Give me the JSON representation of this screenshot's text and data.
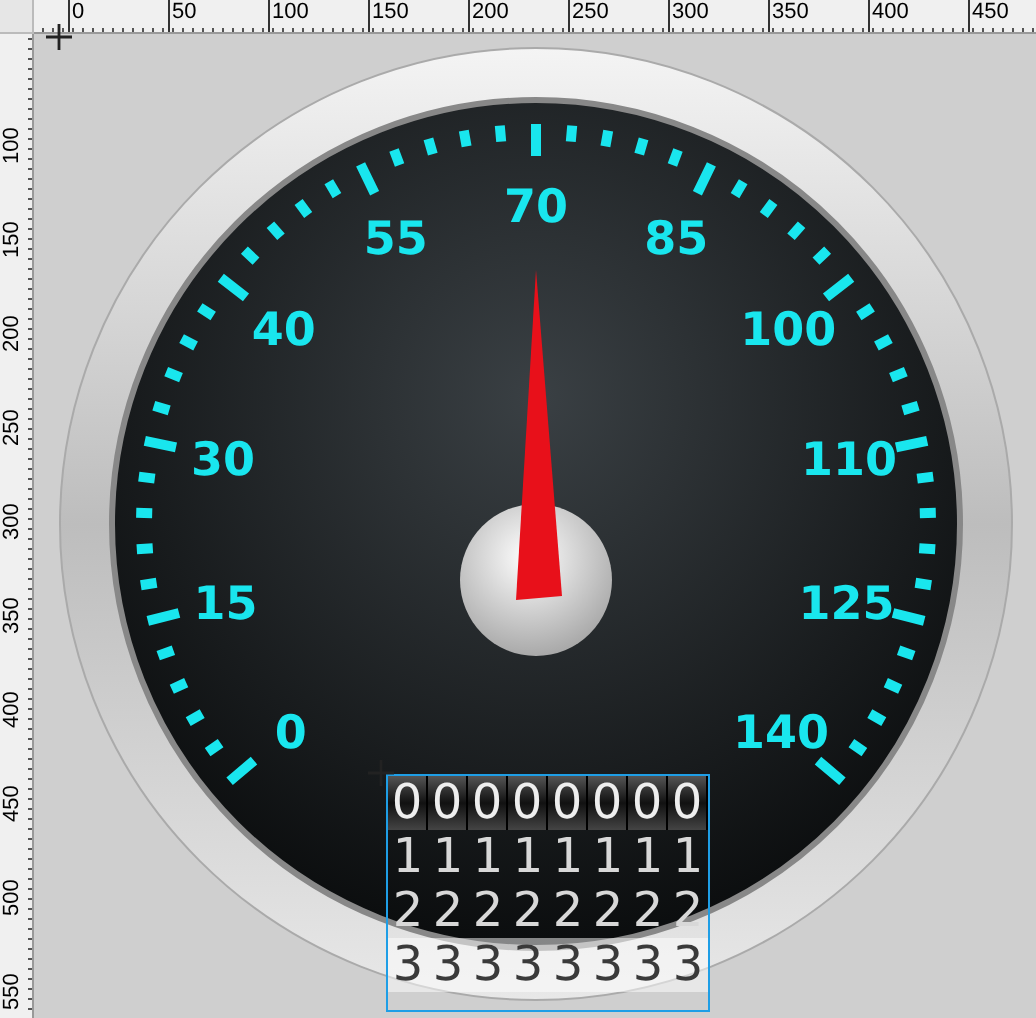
{
  "ruler": {
    "top_labels": [
      "0",
      "50",
      "100",
      "150",
      "200",
      "250",
      "300",
      "350",
      "400",
      "450"
    ],
    "left_labels": [
      "100",
      "150",
      "200",
      "250",
      "300",
      "350",
      "400",
      "450",
      "500",
      "550"
    ]
  },
  "gauge": {
    "scale_labels": [
      "0",
      "15",
      "30",
      "40",
      "55",
      "70",
      "85",
      "100",
      "110",
      "125",
      "140"
    ],
    "needle": {
      "level": 0.5
    },
    "odometer": {
      "columns": [
        [
          "0",
          "1",
          "2",
          "3"
        ],
        [
          "0",
          "1",
          "2",
          "3"
        ],
        [
          "0",
          "1",
          "2",
          "3"
        ],
        [
          "0",
          "1",
          "2",
          "3"
        ],
        [
          "0",
          "1",
          "2",
          "3"
        ],
        [
          "0",
          "1",
          "2",
          "3"
        ],
        [
          "0",
          "1",
          "2",
          "3"
        ],
        [
          "0",
          "1",
          "2",
          "3"
        ]
      ]
    }
  }
}
